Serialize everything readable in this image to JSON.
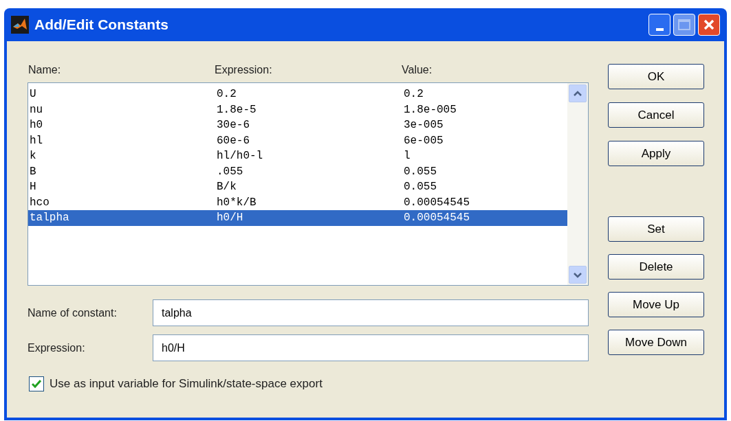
{
  "window": {
    "title": "Add/Edit Constants"
  },
  "columns": [
    "Name:",
    "Expression:",
    "Value:"
  ],
  "rows": [
    {
      "name": "U",
      "expression": "0.2",
      "value": "0.2",
      "selected": false
    },
    {
      "name": "nu",
      "expression": "1.8e-5",
      "value": "1.8e-005",
      "selected": false
    },
    {
      "name": "h0",
      "expression": "30e-6",
      "value": "3e-005",
      "selected": false
    },
    {
      "name": "hl",
      "expression": "60e-6",
      "value": "6e-005",
      "selected": false
    },
    {
      "name": "k",
      "expression": "hl/h0-l",
      "value": "l",
      "selected": false
    },
    {
      "name": "B",
      "expression": ".055",
      "value": "0.055",
      "selected": false
    },
    {
      "name": "H",
      "expression": "B/k",
      "value": "0.055",
      "selected": false
    },
    {
      "name": "hco",
      "expression": "h0*k/B",
      "value": "0.00054545",
      "selected": false
    },
    {
      "name": "talpha",
      "expression": "h0/H",
      "value": "0.00054545",
      "selected": true
    }
  ],
  "fields": [
    {
      "label": "Name of constant:",
      "value": "talpha"
    },
    {
      "label": "Expression:",
      "value": "h0/H"
    }
  ],
  "checkbox": {
    "label": "Use as input variable for Simulink/state-space export",
    "checked": true
  },
  "dialog_buttons": [
    "OK",
    "Cancel",
    "Apply"
  ],
  "list_buttons": [
    "Set",
    "Delete",
    "Move Up",
    "Move Down"
  ]
}
